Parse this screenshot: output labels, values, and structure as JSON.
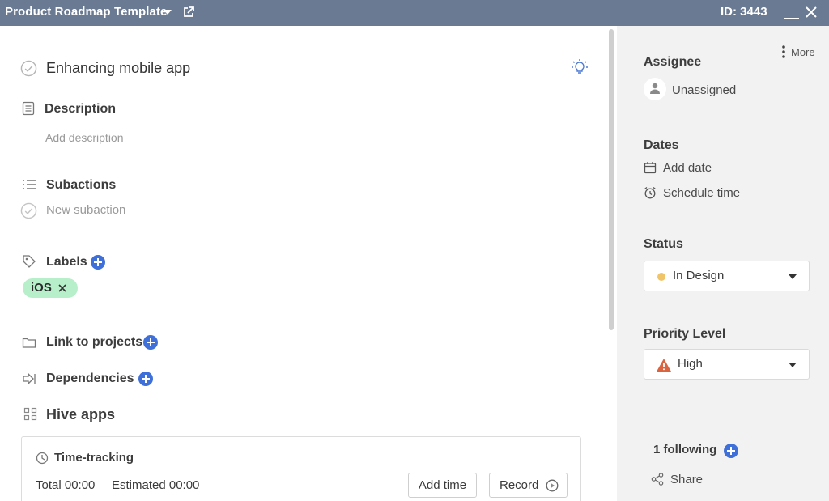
{
  "window": {
    "title": "Product Roadmap Template",
    "id_label": "ID: 3443"
  },
  "task": {
    "title": "Enhancing mobile app"
  },
  "description": {
    "label": "Description",
    "placeholder": "Add description"
  },
  "subactions": {
    "label": "Subactions",
    "placeholder": "New subaction"
  },
  "labels": {
    "label": "Labels",
    "items": [
      {
        "text": "iOS",
        "color": "#b8efcb"
      }
    ]
  },
  "link_projects": {
    "label": "Link to projects"
  },
  "dependencies": {
    "label": "Dependencies"
  },
  "hive_apps": {
    "label": "Hive apps"
  },
  "time_tracking": {
    "title": "Time-tracking",
    "total": "Total 00:00",
    "estimated": "Estimated 00:00",
    "add_time_label": "Add time",
    "record_label": "Record"
  },
  "side": {
    "more_label": "More",
    "assignee": {
      "heading": "Assignee",
      "value": "Unassigned"
    },
    "dates": {
      "heading": "Dates",
      "add_date": "Add date",
      "schedule_time": "Schedule time"
    },
    "status": {
      "heading": "Status",
      "value": "In Design",
      "dot_color": "#f0c46a"
    },
    "priority": {
      "heading": "Priority Level",
      "value": "High",
      "icon": "warning-icon",
      "icon_color": "#d9643f"
    },
    "following": "1 following",
    "share": "Share"
  },
  "colors": {
    "titlebar": "#6b7a93",
    "accent": "#3f6fd8",
    "panel": "#f2f2f2"
  }
}
